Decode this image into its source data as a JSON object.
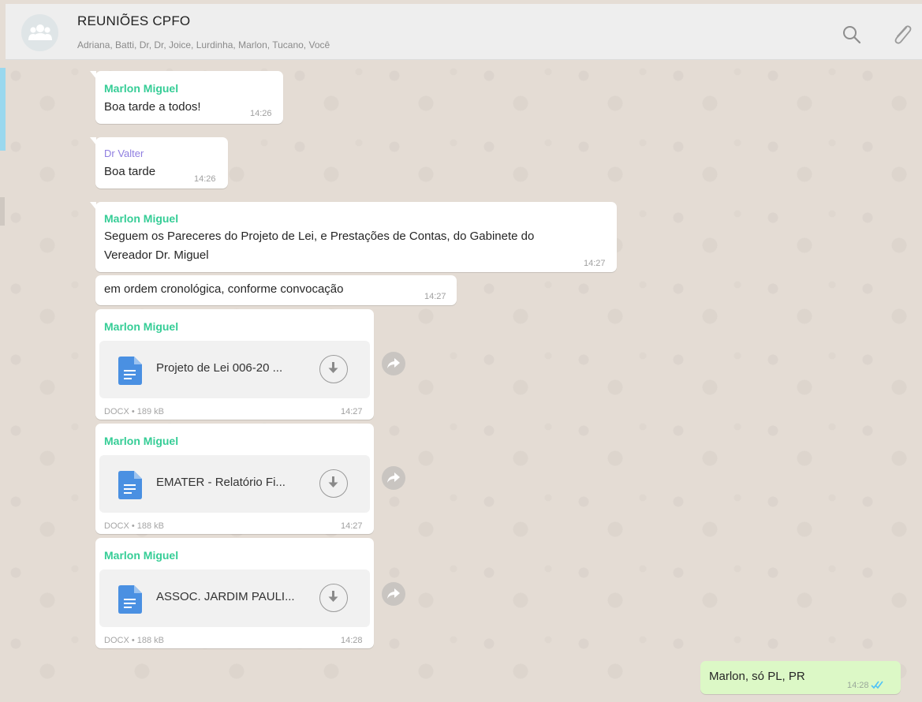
{
  "header": {
    "title": "REUNIÕES CPFO",
    "members": "Adriana, Batti, Dr, Dr, Joice, Lurdinha, Marlon, Tucano, Você",
    "avatar_icon": "group-avatar-icon",
    "search_icon": "search-icon",
    "attach_icon": "paperclip-icon"
  },
  "messages": {
    "m1": {
      "sender": "Marlon Miguel",
      "text": "Boa tarde a todos!",
      "time": "14:26"
    },
    "m2": {
      "sender": "Dr Valter",
      "text": "Boa tarde",
      "time": "14:26"
    },
    "m3": {
      "sender": "Marlon Miguel",
      "line1": "Seguem os Pareceres do Projeto de Lei, e Prestações de Contas, do Gabinete do",
      "line2": "Vereador Dr. Miguel",
      "time": "14:27"
    },
    "m4": {
      "text": "em ordem cronológica, conforme convocação",
      "time": "14:27"
    },
    "d1": {
      "sender": "Marlon Miguel",
      "filename": "Projeto de Lei 006-20 ...",
      "meta": "DOCX • 189 kB",
      "time": "14:27"
    },
    "d2": {
      "sender": "Marlon Miguel",
      "filename": "EMATER - Relatório Fi...",
      "meta": "DOCX • 188 kB",
      "time": "14:27"
    },
    "d3": {
      "sender": "Marlon Miguel",
      "filename": "ASSOC. JARDIM PAULI...",
      "meta": "DOCX • 188 kB",
      "time": "14:28"
    },
    "out1": {
      "text": "Marlon, só PL, PR",
      "time": "14:28",
      "status": "read-double-check"
    }
  },
  "colors": {
    "sender_green": "#35cd96",
    "sender_purple": "#8f7ee0",
    "outgoing_bubble": "#dcf8c6",
    "read_ticks": "#4fc3f7"
  }
}
